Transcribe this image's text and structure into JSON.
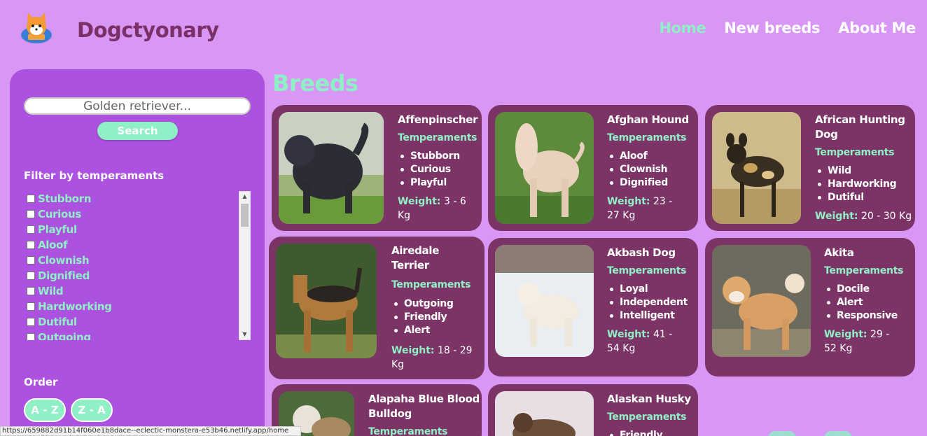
{
  "header": {
    "brand": "Dogctyonary",
    "nav": [
      "Home",
      "New breeds",
      "About Me"
    ]
  },
  "sidebar": {
    "search_placeholder": "Golden retriever...",
    "search_button": "Search",
    "filter_title": "Filter by temperaments",
    "temperaments": [
      "Stubborn",
      "Curious",
      "Playful",
      "Aloof",
      "Clownish",
      "Dignified",
      "Wild",
      "Hardworking",
      "Dutiful",
      "Outgoing"
    ],
    "order_title": "Order",
    "order_az": "A - Z",
    "order_za": "Z - A"
  },
  "main": {
    "title": "Breeds",
    "temperaments_label": "Temperaments",
    "weight_label": "Weight:",
    "cards": [
      {
        "name": "Affenpinscher",
        "temps": [
          "Stubborn",
          "Curious",
          "Playful"
        ],
        "weight": "3 - 6 Kg"
      },
      {
        "name": "Afghan Hound",
        "temps": [
          "Aloof",
          "Clownish",
          "Dignified"
        ],
        "weight": "23 - 27 Kg"
      },
      {
        "name": "African Hunting Dog",
        "temps": [
          "Wild",
          "Hardworking",
          "Dutiful"
        ],
        "weight": "20 - 30 Kg"
      },
      {
        "name": "Airedale Terrier",
        "temps": [
          "Outgoing",
          "Friendly",
          "Alert"
        ],
        "weight": "18 - 29 Kg"
      },
      {
        "name": "Akbash Dog",
        "temps": [
          "Loyal",
          "Independent",
          "Intelligent"
        ],
        "weight": "41 - 54 Kg"
      },
      {
        "name": "Akita",
        "temps": [
          "Docile",
          "Alert",
          "Responsive"
        ],
        "weight": "29 - 52 Kg"
      },
      {
        "name": "Alapaha Blue Blood Bulldog",
        "temps": [],
        "weight": ""
      },
      {
        "name": "Alaskan Husky",
        "temps": [
          "Friendly"
        ],
        "weight": ""
      }
    ]
  },
  "statusbar": {
    "url": "https://659882d91b14f060e1b8dace--eclectic-monstera-e53b46.netlify.app/home"
  }
}
